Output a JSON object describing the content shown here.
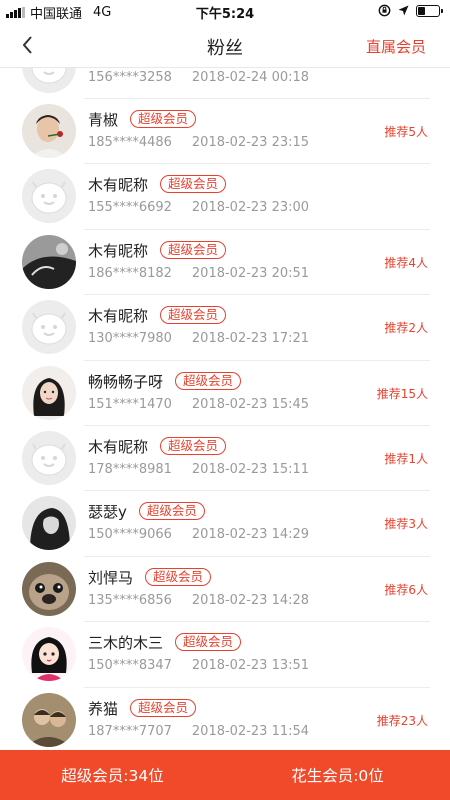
{
  "status_bar": {
    "carrier": "中国联通",
    "network": "4G",
    "time": "下午5:24",
    "battery_level": 0.35
  },
  "nav": {
    "title": "粉丝",
    "action": "直属会员"
  },
  "rows": [
    {
      "avatar": "default",
      "name": "",
      "badge": "",
      "phone": "156****3258",
      "date": "2018-02-24 00:18",
      "recommend": ""
    },
    {
      "avatar": "man-with-rose",
      "name": "青椒",
      "badge": "超级会员",
      "phone": "185****4486",
      "date": "2018-02-23 23:15",
      "recommend": "推荐5人"
    },
    {
      "avatar": "default",
      "name": "木有昵称",
      "badge": "超级会员",
      "phone": "155****6692",
      "date": "2018-02-23 23:00",
      "recommend": ""
    },
    {
      "avatar": "bw-photo",
      "name": "木有昵称",
      "badge": "超级会员",
      "phone": "186****8182",
      "date": "2018-02-23 20:51",
      "recommend": "推荐4人"
    },
    {
      "avatar": "default",
      "name": "木有昵称",
      "badge": "超级会员",
      "phone": "130****7980",
      "date": "2018-02-23 17:21",
      "recommend": "推荐2人"
    },
    {
      "avatar": "woman-photo",
      "name": "畅畅畅子呀",
      "badge": "超级会员",
      "phone": "151****1470",
      "date": "2018-02-23 15:45",
      "recommend": "推荐15人"
    },
    {
      "avatar": "default",
      "name": "木有昵称",
      "badge": "超级会员",
      "phone": "178****8981",
      "date": "2018-02-23 15:11",
      "recommend": "推荐1人"
    },
    {
      "avatar": "bw-woman",
      "name": "瑟瑟y",
      "badge": "超级会员",
      "phone": "150****9066",
      "date": "2018-02-23 14:29",
      "recommend": "推荐3人"
    },
    {
      "avatar": "pug-dog",
      "name": "刘悍马",
      "badge": "超级会员",
      "phone": "135****6856",
      "date": "2018-02-23 14:28",
      "recommend": "推荐6人"
    },
    {
      "avatar": "cartoon-girl",
      "name": "三木的木三",
      "badge": "超级会员",
      "phone": "150****8347",
      "date": "2018-02-23 13:51",
      "recommend": ""
    },
    {
      "avatar": "couple-photo",
      "name": "养猫",
      "badge": "超级会员",
      "phone": "187****7707",
      "date": "2018-02-23 11:54",
      "recommend": "推荐23人"
    }
  ],
  "bottom_bar": {
    "left": "超级会员:34位",
    "right": "花生会员:0位"
  },
  "colors": {
    "accent": "#e8422f",
    "bottom_bar": "#f04a2a",
    "default_avatar_bg": "#ececec"
  }
}
